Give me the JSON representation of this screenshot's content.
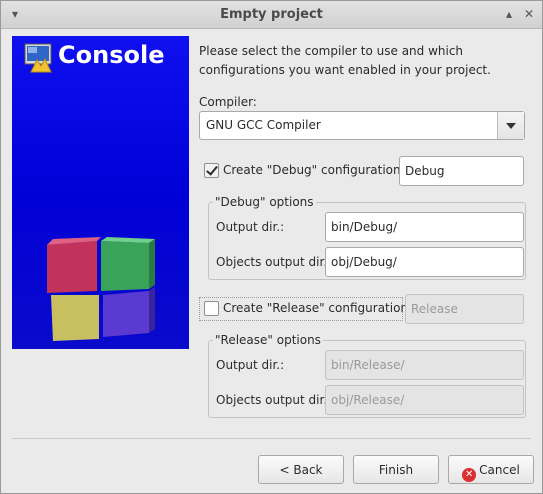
{
  "window": {
    "title": "Empty project"
  },
  "banner": {
    "title": "Console",
    "colors": {
      "background": "#0000e0",
      "cube_red": "#c2325a",
      "cube_green": "#3aa35a",
      "cube_yellow": "#c8c060",
      "cube_purple": "#5a3ad0"
    }
  },
  "intro": "Please select the compiler to use and which configurations you want enabled in your project.",
  "compiler": {
    "label": "Compiler:",
    "selected": "GNU GCC Compiler"
  },
  "debug": {
    "checkbox_label": "Create \"Debug\" configuration:",
    "checked": true,
    "name": "Debug",
    "group_title": "\"Debug\" options",
    "output_dir_label": "Output dir.:",
    "output_dir": "bin/Debug/",
    "objects_dir_label": "Objects output dir.:",
    "objects_dir": "obj/Debug/"
  },
  "release": {
    "checkbox_label": "Create \"Release\" configuration:",
    "checked": false,
    "name": "Release",
    "group_title": "\"Release\" options",
    "output_dir_label": "Output dir.:",
    "output_dir": "bin/Release/",
    "objects_dir_label": "Objects output dir.:",
    "objects_dir": "obj/Release/"
  },
  "buttons": {
    "back": "< Back",
    "finish": "Finish",
    "cancel": "Cancel"
  }
}
